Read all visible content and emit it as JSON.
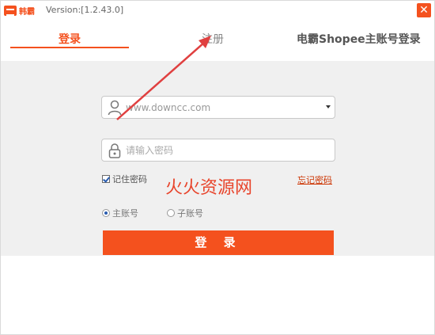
{
  "window": {
    "version": "Version:[1.2.43.0]",
    "close_glyph": "✕",
    "logo_text": "韩霸"
  },
  "tabs": {
    "login": "登录",
    "register": "注册",
    "shopee": "电霸Shopee主账号登录"
  },
  "form": {
    "username_value": "www.downcc.com",
    "password_placeholder": "请输入密码",
    "remember_label": "记住密码",
    "forgot_label": "忘记密码",
    "watermark": "火火资源网",
    "radio_main": "主账号",
    "radio_sub": "子账号",
    "submit_label": "登 录"
  },
  "colors": {
    "accent": "#f4511e",
    "panel": "#f0f0f0",
    "annotation": "#e04040"
  },
  "icons": [
    "logo-icon",
    "close-icon",
    "user-icon",
    "lock-icon",
    "dropdown-arrow-icon",
    "checkbox-icon",
    "radio-icon",
    "arrow-annotation-icon"
  ]
}
